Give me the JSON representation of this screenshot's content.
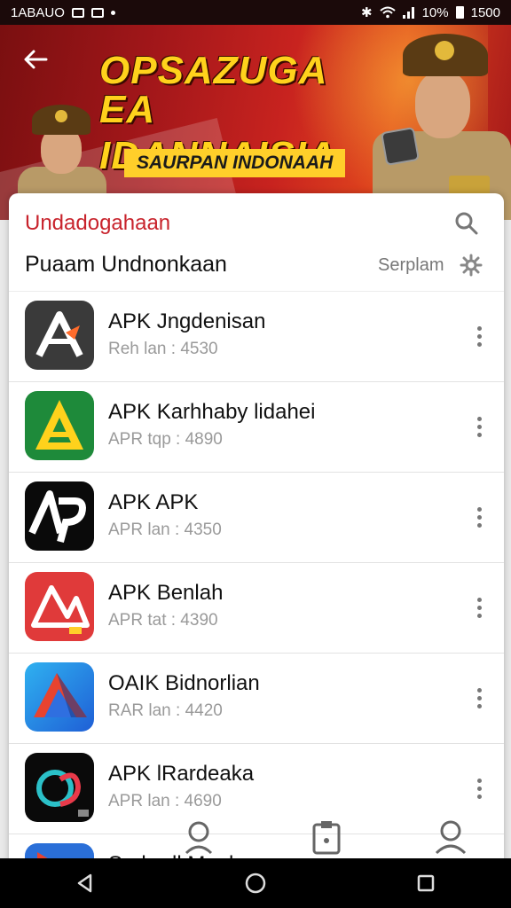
{
  "status_bar": {
    "left_text": "1ABAUO",
    "right_text": "10%",
    "time": "1500"
  },
  "banner": {
    "title_line1": "OPSAZUGA EA",
    "title_line2": "IDANNAISIA",
    "subtitle": "SAURPAN INDONAAH"
  },
  "header": {
    "title": "Undadogahaan",
    "subtitle": "Puaam Undnonkaan",
    "sort_label": "Serplam"
  },
  "apps": [
    {
      "name": "APK Jngdenisan",
      "meta": "Reh lan : 4530",
      "icon": "a-arrow-dark-icon"
    },
    {
      "name": "APK Karhhaby lidahei",
      "meta": "APR tqp : 4890",
      "icon": "a-green-yellow-icon"
    },
    {
      "name": "APK APK",
      "meta": "APR lan : 4350",
      "icon": "apk-black-icon"
    },
    {
      "name": "APK Benlah",
      "meta": "APR tat : 4390",
      "icon": "a-red-icon"
    },
    {
      "name": "OAIK Bidnorlian",
      "meta": "RAR lan : 4420",
      "icon": "a-blue-icon"
    },
    {
      "name": "APK lRardeaka",
      "meta": "APR lan : 4690",
      "icon": "heart-loop-icon"
    },
    {
      "name": "Sarlardl Mnala",
      "meta": "",
      "icon": "play-partial-icon"
    }
  ],
  "colors": {
    "accent": "#c8232c",
    "banner_yellow": "#ffd21c"
  }
}
